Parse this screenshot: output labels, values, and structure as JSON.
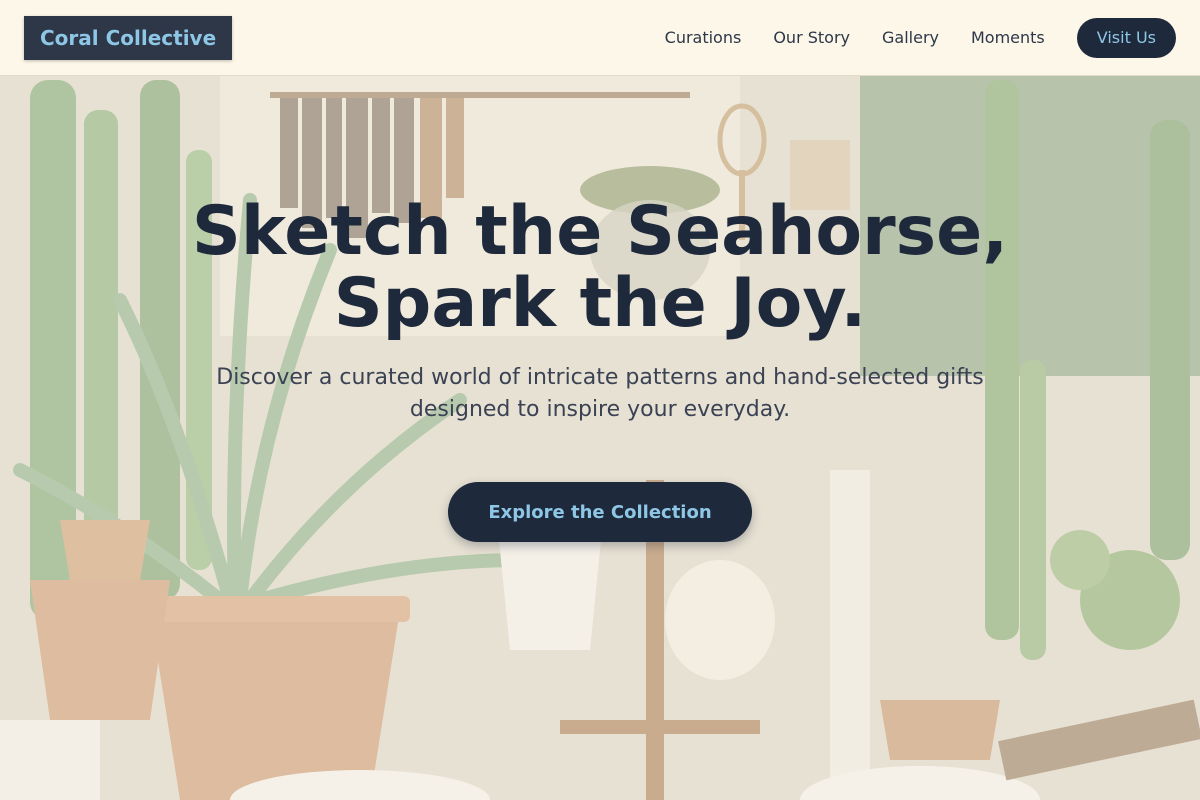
{
  "header": {
    "logo_text": "Coral Collective",
    "nav": [
      {
        "label": "Curations"
      },
      {
        "label": "Our Story"
      },
      {
        "label": "Gallery"
      },
      {
        "label": "Moments"
      }
    ],
    "visit_label": "Visit Us"
  },
  "hero": {
    "title": "Sketch the Seahorse, Spark the Joy.",
    "subtitle": "Discover a curated world of intricate patterns and hand-selected gifts designed to inspire your everyday.",
    "cta_label": "Explore the Collection"
  },
  "colors": {
    "brand_dark": "#1e293b",
    "accent_blue": "#8ec7e6",
    "header_bg": "#fdf8ea"
  }
}
